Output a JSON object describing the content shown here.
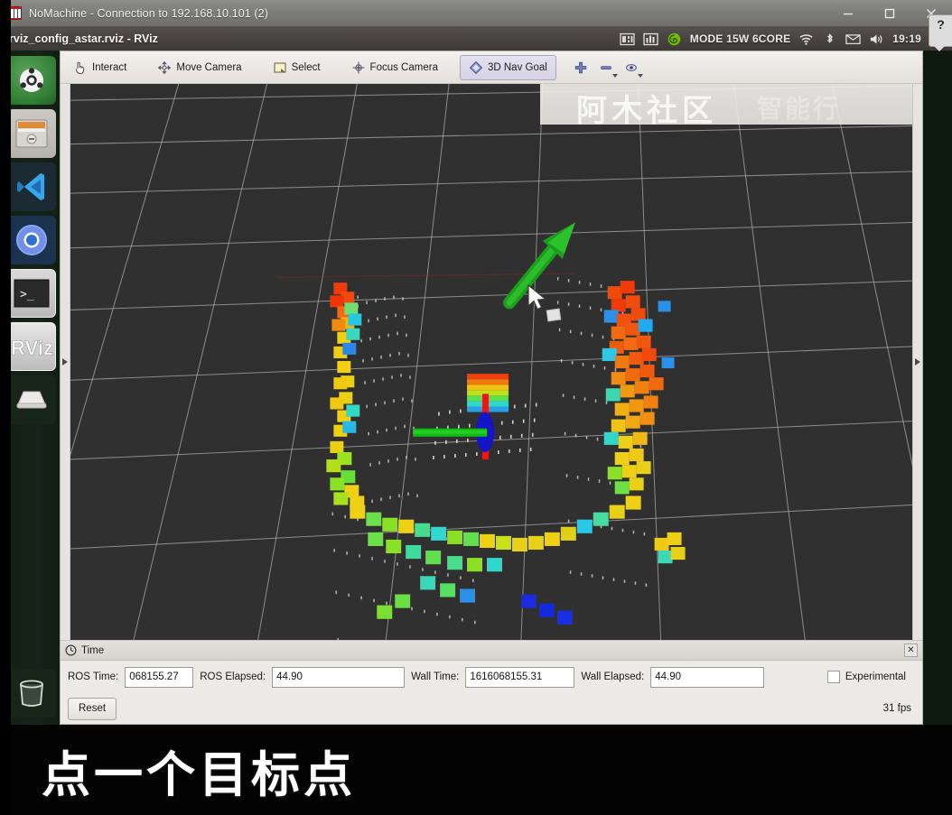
{
  "window": {
    "title": "NoMachine - Connection to 192.168.10.101 (2)",
    "app_icon": "nomachine-icon",
    "minimize_label": "–",
    "maximize_label": "□",
    "close_label": "✕",
    "help_label": "?"
  },
  "unity_panel": {
    "app_name": "rviz_config_astar.rviz - RViz",
    "tray": {
      "mode_text": "MODE 15W 6CORE",
      "clock": "19:19",
      "icons": [
        "system-monitor-icon",
        "chart-icon",
        "nvidia-icon",
        "wifi-icon",
        "bluetooth-icon",
        "mail-icon",
        "volume-icon",
        "battery-icon",
        "settings-gear-icon"
      ]
    }
  },
  "launcher": {
    "items": [
      {
        "name": "ubuntu-dash",
        "icon": "ubuntu-logo-icon"
      },
      {
        "name": "files",
        "icon": "file-manager-icon"
      },
      {
        "name": "vscode",
        "icon": "vscode-icon"
      },
      {
        "name": "chromium",
        "icon": "chromium-icon"
      },
      {
        "name": "terminal",
        "icon": "terminal-icon"
      },
      {
        "name": "rviz",
        "icon": "rviz-icon",
        "label": "RViz"
      },
      {
        "name": "disk",
        "icon": "disk-drive-icon"
      },
      {
        "name": "trash",
        "icon": "trash-icon"
      }
    ]
  },
  "rviz": {
    "toolbar": {
      "interact": "Interact",
      "move_camera": "Move Camera",
      "select": "Select",
      "focus_camera": "Focus Camera",
      "nav_goal": "3D Nav Goal",
      "active_tool": "3D Nav Goal",
      "icon_buttons": [
        "add-tool-icon",
        "remove-tool-icon",
        "tool-properties-icon"
      ]
    },
    "viewport": {
      "watermark": "阿木社区",
      "watermark_secondary": "智能行",
      "background_color": "#303030",
      "grid_color": "#b4b4b4",
      "left_panel_handle": "expand-left-panel",
      "right_panel_handle": "expand-right-panel",
      "cursor": "mouse-cursor-arrow",
      "nav_goal_arrow_color": "#1ea81e",
      "axes_colors": {
        "x": "#ff2020",
        "y": "#18c418",
        "z": "#1a1ad0"
      }
    },
    "time_panel": {
      "title": "Time",
      "close_label": "✕",
      "ros_time_label": "ROS Time:",
      "ros_time_value": "068155.27",
      "ros_elapsed_label": "ROS Elapsed:",
      "ros_elapsed_value": "44.90",
      "wall_time_label": "Wall Time:",
      "wall_time_value": "1616068155.31",
      "wall_elapsed_label": "Wall Elapsed:",
      "wall_elapsed_value": "44.90",
      "experimental_label": "Experimental",
      "experimental_checked": false,
      "reset_label": "Reset",
      "fps": "31 fps"
    }
  },
  "caption": {
    "text": "点一个目标点"
  }
}
